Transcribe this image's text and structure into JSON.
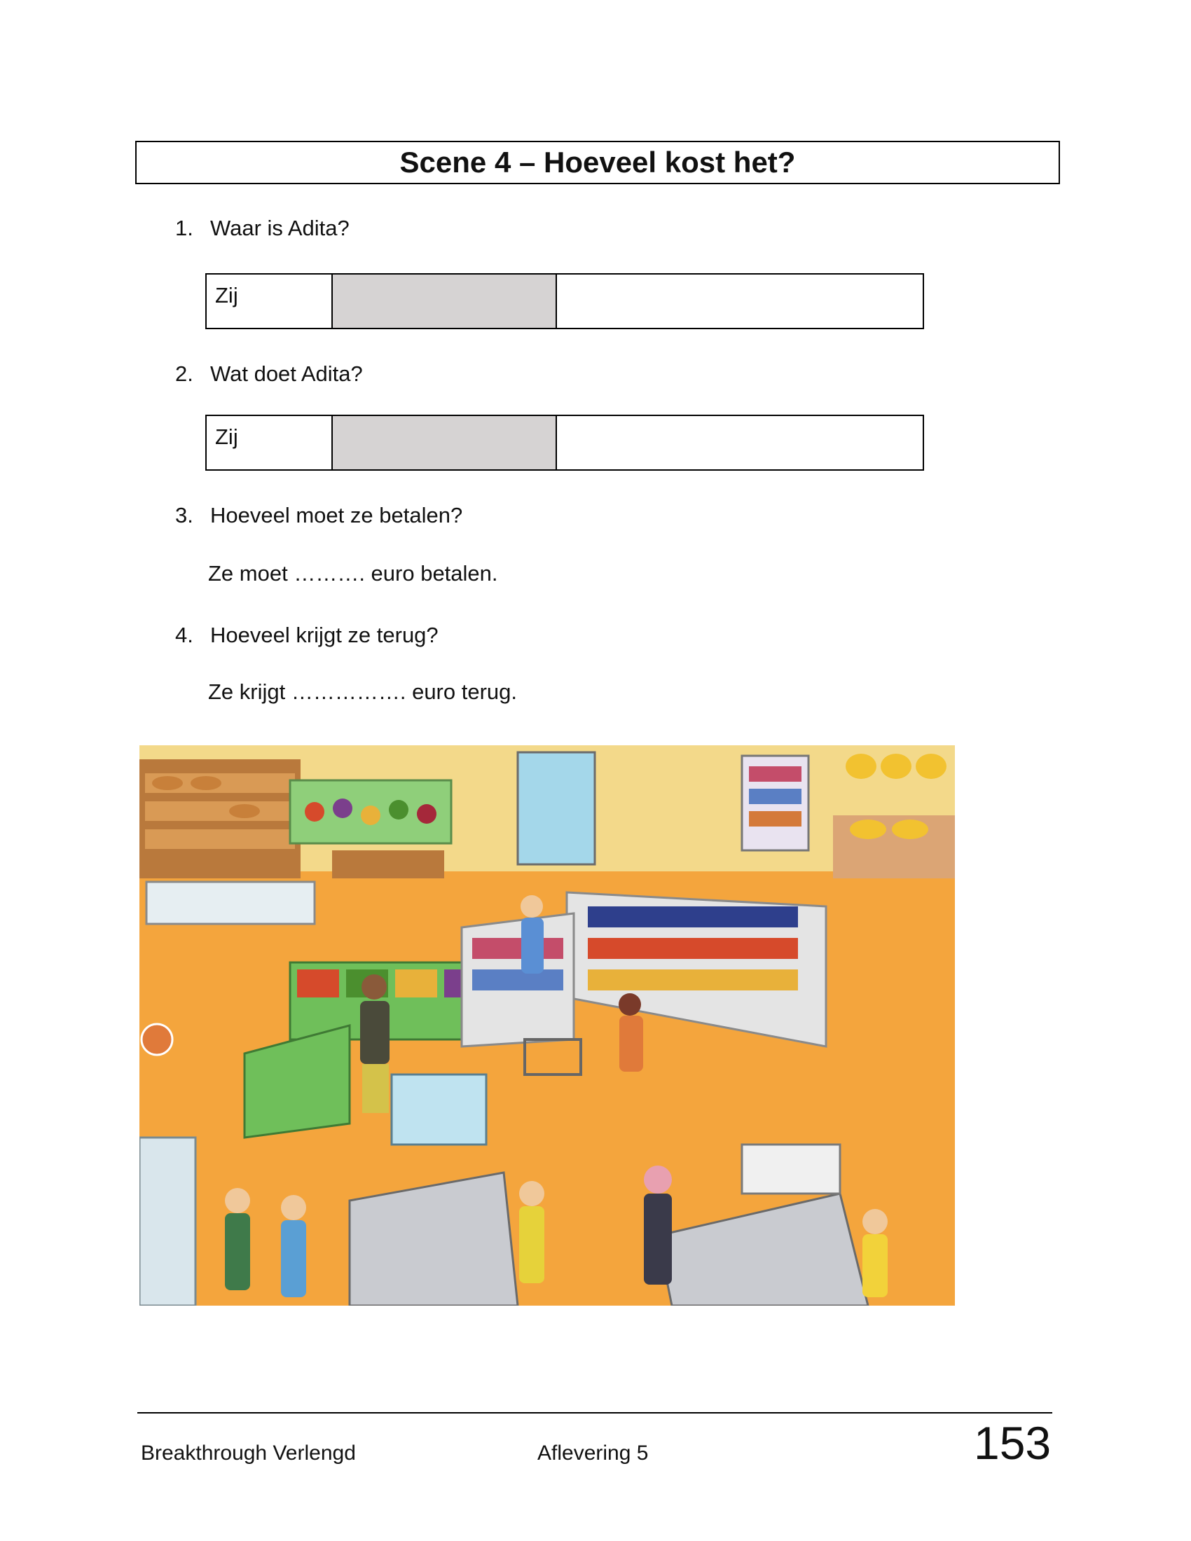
{
  "title": "Scene 4 – Hoeveel kost het?",
  "questions": [
    {
      "number": "1.",
      "text": "Waar is Adita?"
    },
    {
      "number": "2.",
      "text": "Wat doet Adita?"
    },
    {
      "number": "3.",
      "text": "Hoeveel moet ze betalen?"
    },
    {
      "number": "4.",
      "text": "Hoeveel krijgt ze terug?"
    }
  ],
  "answer_rows": [
    {
      "subject": "Zij",
      "verb": "",
      "rest": ""
    },
    {
      "subject": "Zij",
      "verb": "",
      "rest": ""
    }
  ],
  "fill_ins": [
    "Ze moet ………. euro betalen.",
    "Ze krijgt ……………. euro terug."
  ],
  "illustration": {
    "label": "supermarket-scene"
  },
  "footer": {
    "book": "Breakthrough Verlengd",
    "episode": "Aflevering 5",
    "page": "153"
  }
}
